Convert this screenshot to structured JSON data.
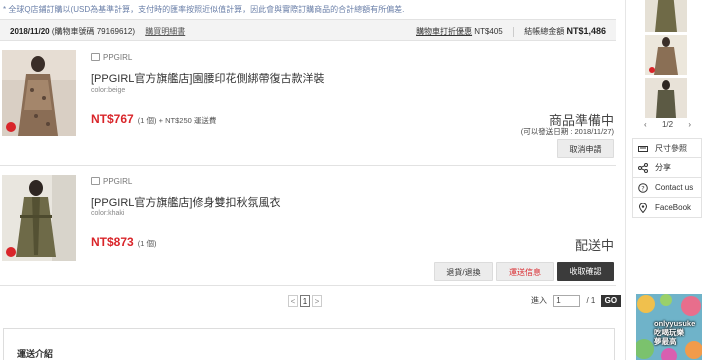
{
  "notice": "* 全球Q店鋪訂購以(USD為基準計算，支付時的匯率按照近似值計算，因此會與實際訂購商品的合計總額有所偏差.",
  "order": {
    "date": "2018/11/20",
    "order_no_label": "(購物車號碼 79169612)",
    "receipt_link": "購買明細書",
    "cart_discount_label": "購物車打折優惠",
    "cart_discount_value": "NT$405",
    "total_label": "結帳總金額",
    "total_value": "NT$1,486"
  },
  "items": [
    {
      "shop": "PPGIRL",
      "title": "[PPGIRL官方旗艦店]園腰印花側綁帶復古款洋裝",
      "color": "color:beige",
      "price": "NT$767",
      "qty": "(1 個)",
      "shipping": "+ NT$250 運送費",
      "status": "商品準備中",
      "ship_date": "(可以發送日期 : 2018/11/27)",
      "buttons": [
        "取消申請"
      ]
    },
    {
      "shop": "PPGIRL",
      "title": "[PPGIRL官方旗艦店]修身雙扣秋氛風衣",
      "color": "color:khaki",
      "price": "NT$873",
      "qty": "(1 個)",
      "status": "配送中",
      "buttons": [
        "退貨/退換",
        "運送信息",
        "收取確認"
      ]
    }
  ],
  "pager": {
    "prev": "<",
    "current": "1",
    "next": ">"
  },
  "jump": {
    "label": "進入",
    "value": "1",
    "total": "/ 1",
    "go": "GO"
  },
  "shipping_section": {
    "title": "運送介紹"
  },
  "sidebar": {
    "page_indicator": "1/2",
    "menu": [
      {
        "label": "尺寸參照",
        "icon": "ruler-icon"
      },
      {
        "label": "分享",
        "icon": "share-icon"
      },
      {
        "label": "Contact us",
        "icon": "help-icon"
      },
      {
        "label": "FaceBook",
        "icon": "location-icon"
      }
    ],
    "ad_text_1": "onlyyusuke",
    "ad_text_2": "吃喝玩樂",
    "ad_text_3": "夢最高"
  },
  "colors": {
    "price_red": "#d9252a",
    "dark_button": "#3b3b3b",
    "header_bg": "#f3f3f3"
  }
}
